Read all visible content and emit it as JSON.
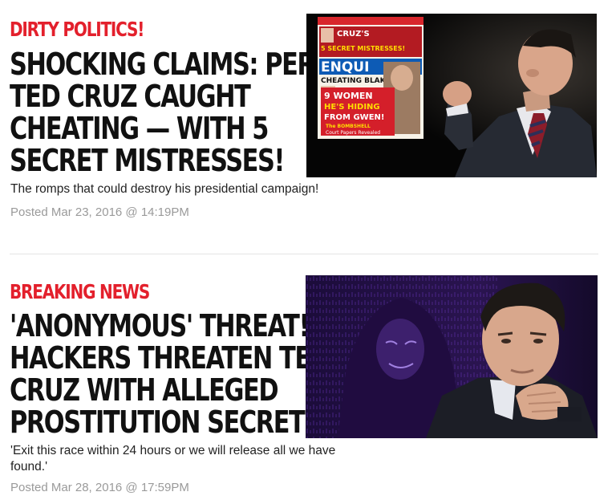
{
  "articles": [
    {
      "category": "DIRTY POLITICS!",
      "headline_lines": [
        "SHOCKING CLAIMS: PERVY",
        "TED CRUZ CAUGHT",
        "CHEATING — WITH 5",
        "SECRET MISTRESSES!"
      ],
      "dek": "The romps that could destroy his presidential campaign!",
      "posted": "Posted Mar 23, 2016 @ 14:19PM",
      "magazine": {
        "cover_lines": [
          "CRUZ'S",
          "5 SECRET MISTRESSES!",
          "ENQUI",
          "CHEATING BLAKE:",
          "9 WOMEN",
          "HE'S HIDING",
          "FROM GWEN!",
          "The BOMBSHELL",
          "Court Papers Revealed"
        ]
      }
    },
    {
      "category": "BREAKING NEWS",
      "headline_lines": [
        "'ANONYMOUS' THREAT!",
        "HACKERS THREATEN TED",
        "CRUZ WITH ALLEGED",
        "PROSTITUTION SECRET"
      ],
      "dek": "'Exit this race within 24 hours or we will release all we have found.'",
      "posted": "Posted Mar 28, 2016 @ 17:59PM"
    }
  ],
  "colors": {
    "category": "#e3202c",
    "headline": "#111111",
    "posted": "#9a9a9a"
  }
}
